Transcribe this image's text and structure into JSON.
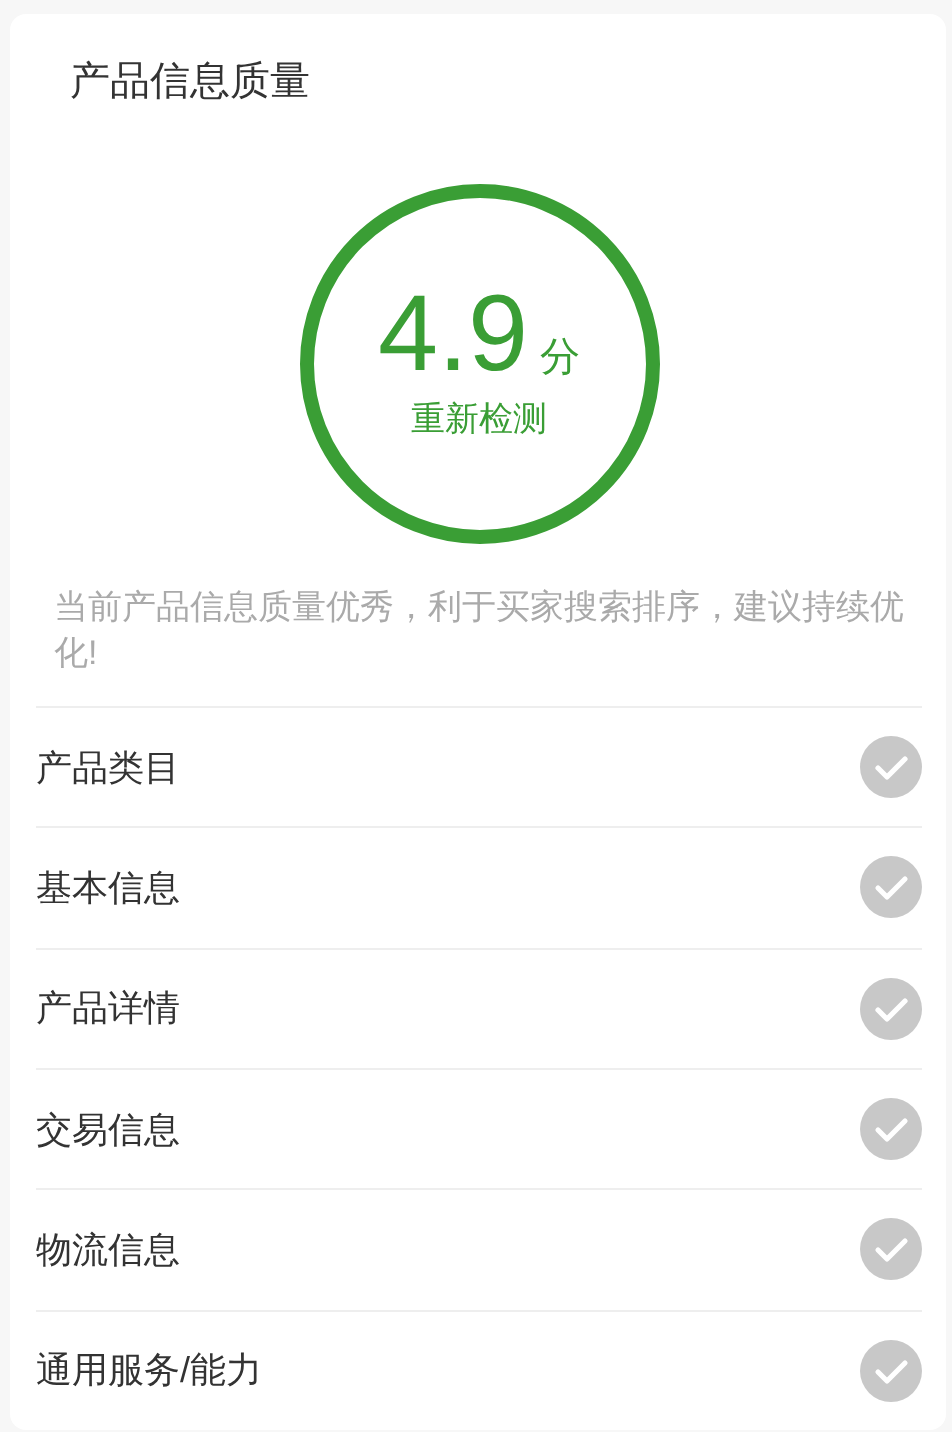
{
  "title": "产品信息质量",
  "score": {
    "value": "4.9",
    "unit": "分",
    "action": "重新检测"
  },
  "description": "当前产品信息质量优秀，利于买家搜索排序，建议持续优化!",
  "items": [
    {
      "label": "产品类目",
      "checked": true
    },
    {
      "label": "基本信息",
      "checked": true
    },
    {
      "label": "产品详情",
      "checked": true
    },
    {
      "label": "交易信息",
      "checked": true
    },
    {
      "label": "物流信息",
      "checked": true
    },
    {
      "label": "通用服务/能力",
      "checked": true
    }
  ]
}
